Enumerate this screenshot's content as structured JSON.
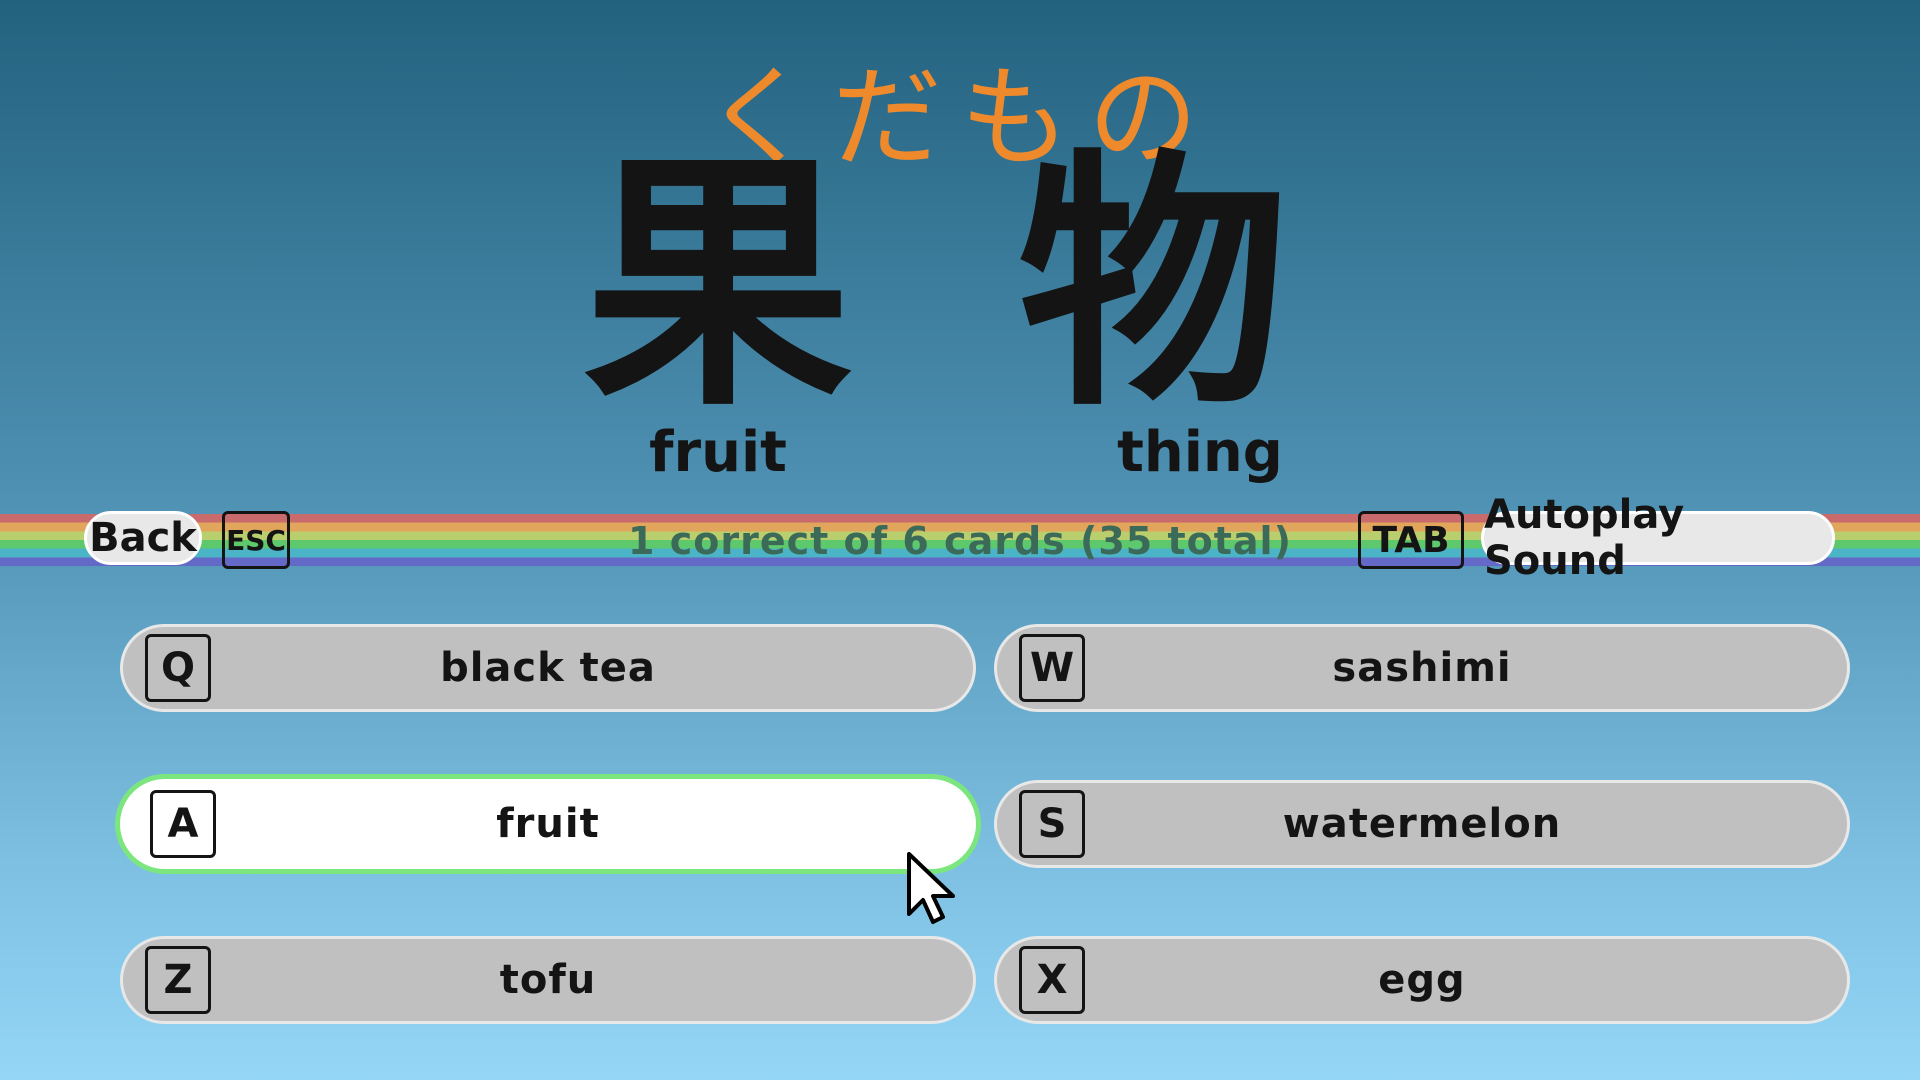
{
  "card": {
    "reading": "くだもの",
    "kanji": [
      {
        "char": "果",
        "gloss": "fruit"
      },
      {
        "char": "物",
        "gloss": "thing"
      }
    ]
  },
  "toolbar": {
    "back_label": "Back",
    "back_key": "ESC",
    "progress": "1 correct of 6 cards (35 total)",
    "autoplay_key": "TAB",
    "autoplay_label": "Autoplay Sound"
  },
  "choices": [
    {
      "key": "Q",
      "label": "black tea",
      "selected": false
    },
    {
      "key": "W",
      "label": "sashimi",
      "selected": false
    },
    {
      "key": "A",
      "label": "fruit",
      "selected": true
    },
    {
      "key": "S",
      "label": "watermelon",
      "selected": false
    },
    {
      "key": "Z",
      "label": "tofu",
      "selected": false
    },
    {
      "key": "X",
      "label": "egg",
      "selected": false
    }
  ],
  "colors": {
    "reading": "#ee8a2c",
    "selected_border": "#7ce67e",
    "choice_bg": "#c0c0c0"
  }
}
